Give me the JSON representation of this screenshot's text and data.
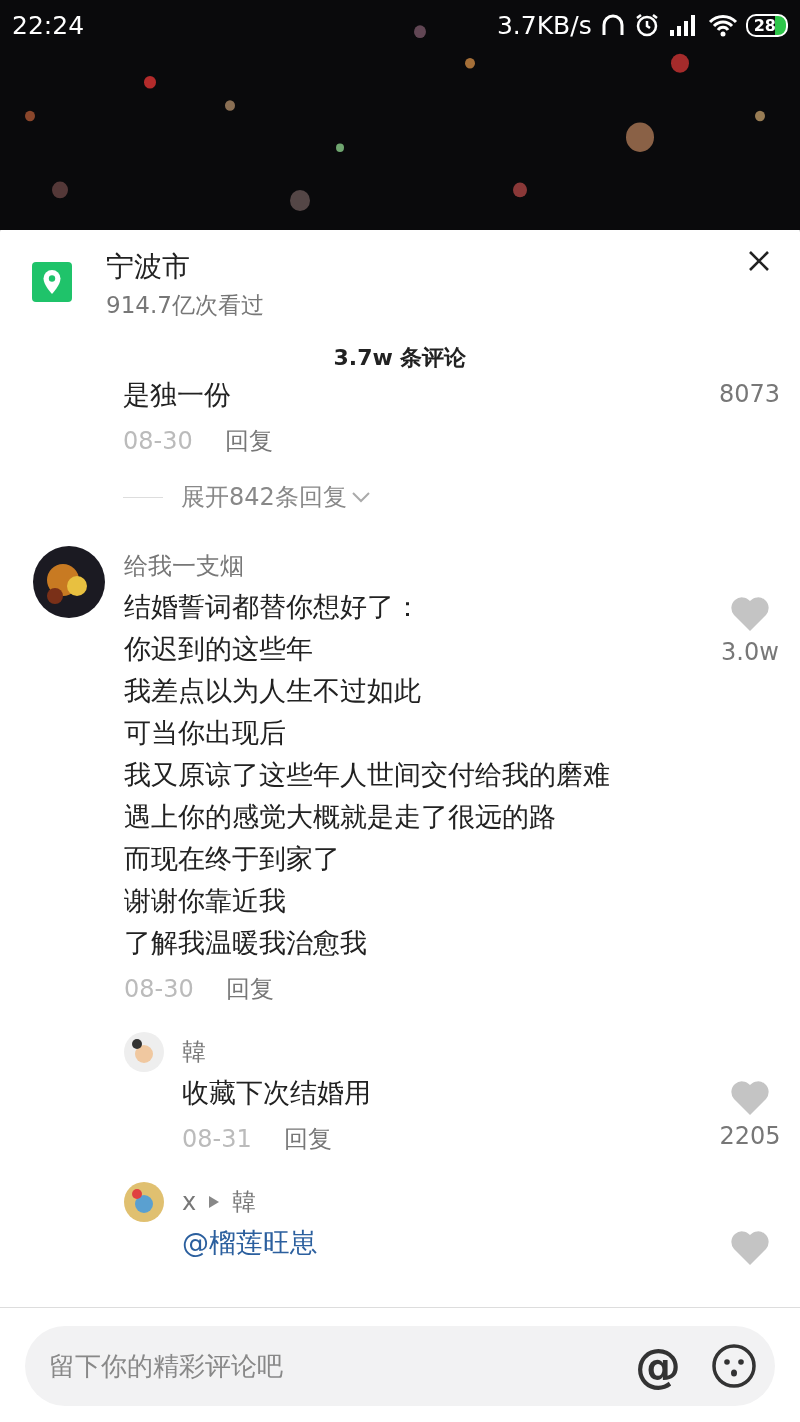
{
  "status_bar": {
    "time": "22:24",
    "speed": "3.7KB/s",
    "battery": "28"
  },
  "location": {
    "title": "宁波市",
    "views": "914.7亿次看过"
  },
  "comments_header": "3.7w 条评论",
  "partial_comment": {
    "text": "是独一份",
    "likes": "8073",
    "date": "08-30",
    "reply_label": "回复",
    "expand_label": "展开842条回复"
  },
  "comment": {
    "author": "给我一支烟",
    "lines": [
      "结婚誓词都替你想好了：",
      "你迟到的这些年",
      "我差点以为人生不过如此",
      "可当你出现后",
      "我又原谅了这些年人世间交付给我的磨难",
      "遇上你的感觉大概就是走了很远的路",
      "而现在终于到家了",
      "谢谢你靠近我",
      "了解我温暖我治愈我"
    ],
    "likes": "3.0w",
    "date": "08-30",
    "reply_label": "回复"
  },
  "replies": [
    {
      "author": "韓",
      "text": "收藏下次结婚用",
      "likes": "2205",
      "date": "08-31",
      "reply_label": "回复"
    },
    {
      "author": "x",
      "reply_to": "韓",
      "mention": "@榴莲旺崽"
    }
  ],
  "input": {
    "placeholder": "留下你的精彩评论吧",
    "at_label": "@"
  }
}
